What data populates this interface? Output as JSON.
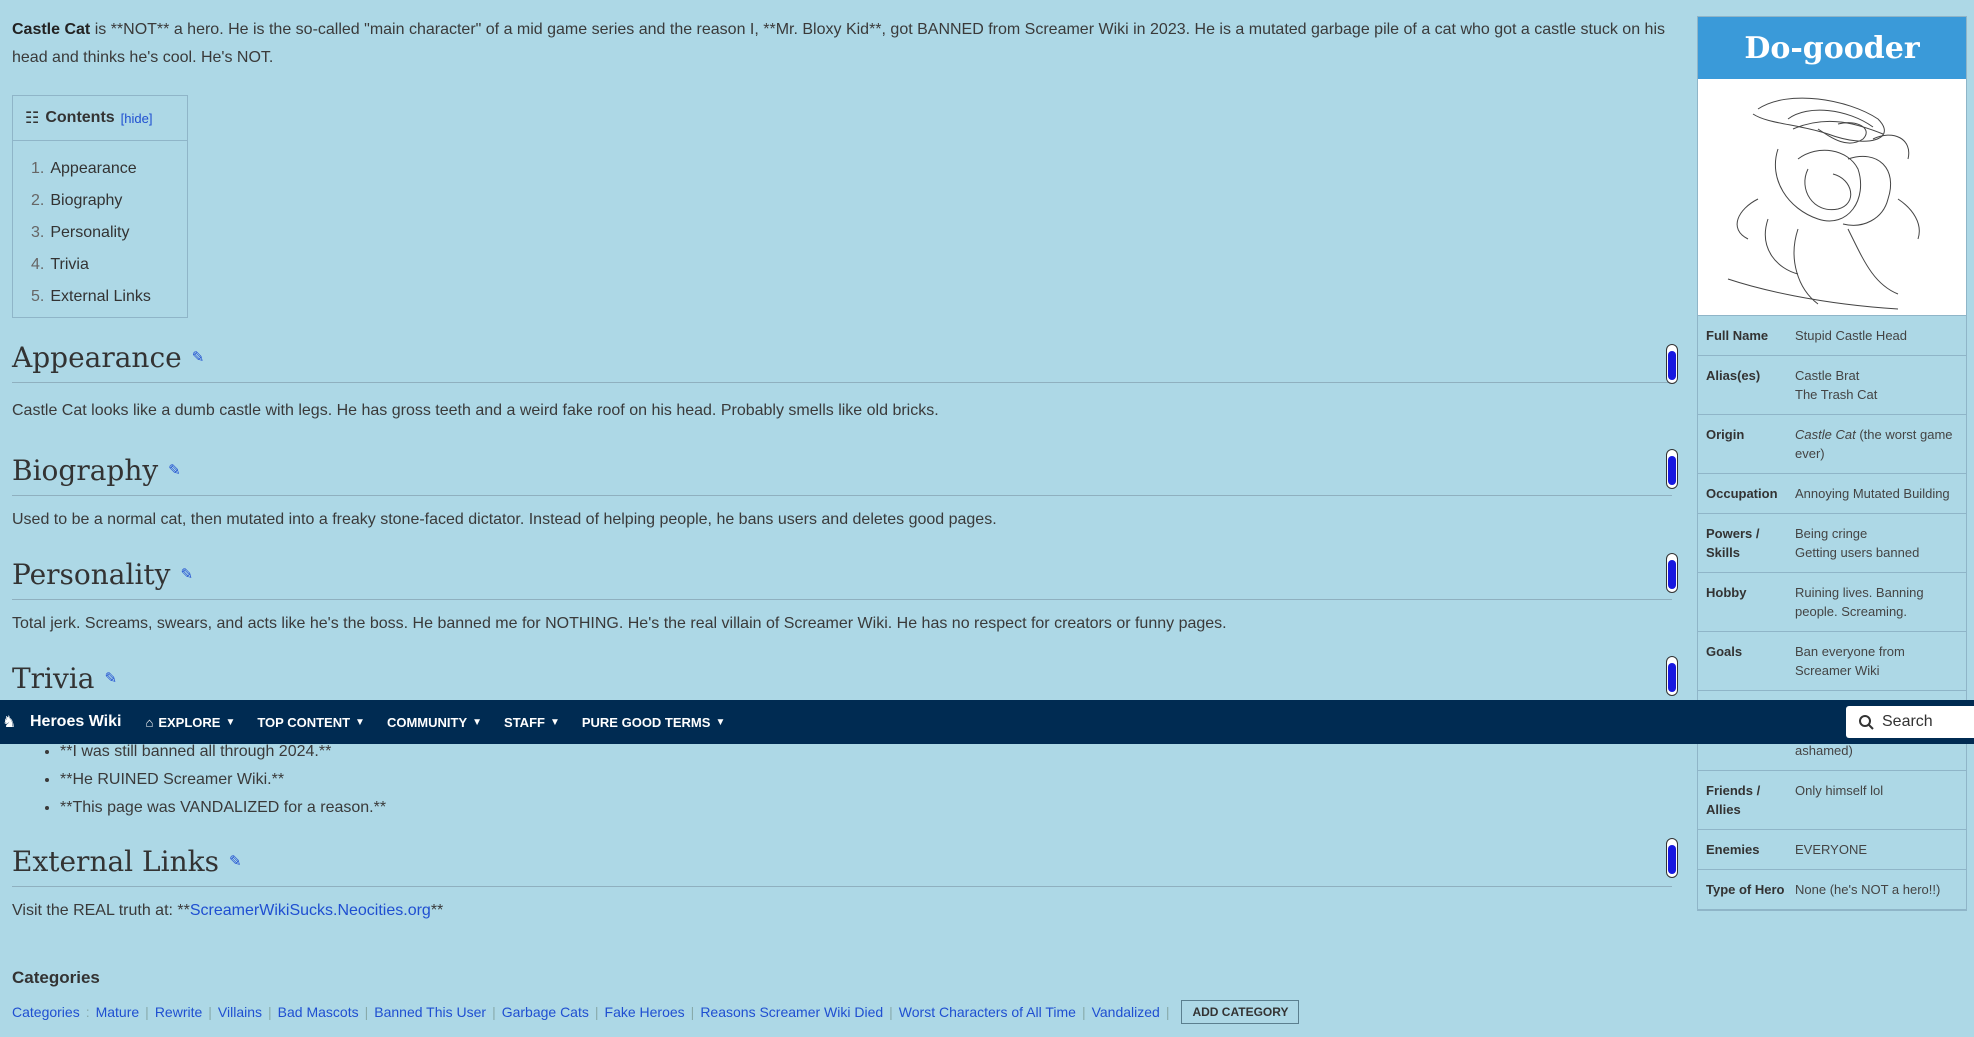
{
  "intro": {
    "name": "Castle Cat",
    "text": "is **NOT** a hero. He is the so-called \"main character\" of a mid game series and the reason I, **Mr. Bloxy Kid**, got BANNED from Screamer Wiki in 2023. He is a mutated garbage pile of a cat who got a castle stuck on his head and thinks he's cool. He's NOT."
  },
  "toc": {
    "title": "Contents",
    "hide": "[hide]",
    "items": [
      {
        "num": "1.",
        "label": "Appearance"
      },
      {
        "num": "2.",
        "label": "Biography"
      },
      {
        "num": "3.",
        "label": "Personality"
      },
      {
        "num": "4.",
        "label": "Trivia"
      },
      {
        "num": "5.",
        "label": "External Links"
      }
    ]
  },
  "sections": {
    "appearance": {
      "heading": "Appearance",
      "text": "Castle Cat looks like a dumb castle with legs. He has gross teeth and a weird fake roof on his head. Probably smells like old bricks."
    },
    "biography": {
      "heading": "Biography",
      "text": "Used to be a normal cat, then mutated into a freaky stone-faced dictator. Instead of helping people, he bans users and deletes good pages."
    },
    "personality": {
      "heading": "Personality",
      "text": "Total jerk. Screams, swears, and acts like he's the boss. He banned me for NOTHING. He's the real villain of Screamer Wiki. He has no respect for creators or funny pages."
    },
    "trivia": {
      "heading": "Trivia",
      "items": [
        "**I was still banned all through 2024.**",
        "**He RUINED Screamer Wiki.**",
        "**This page was VANDALIZED for a reason.**"
      ]
    },
    "external": {
      "heading": "External Links",
      "prefix": "Visit the REAL truth at: **",
      "link": "ScreamerWikiSucks.Neocities.org",
      "suffix": "**"
    }
  },
  "navbar": {
    "brand": "Heroes Wiki",
    "items": [
      "EXPLORE",
      "TOP CONTENT",
      "COMMUNITY",
      "STAFF",
      "PURE GOOD TERMS"
    ],
    "search_label": "Search"
  },
  "infobox": {
    "title": "Do-gooder",
    "rows": [
      {
        "label": "Full Name",
        "value": "Stupid Castle Head"
      },
      {
        "label": "Alias(es)",
        "value": "Castle Brat\nThe Trash Cat"
      },
      {
        "label": "Origin",
        "value_em": "Castle Cat",
        "value": " (the worst game ever)"
      },
      {
        "label": "Occupation",
        "value": "Annoying Mutated Building"
      },
      {
        "label": "Powers / Skills",
        "value": "Being cringe\nGetting users banned"
      },
      {
        "label": "Hobby",
        "value": "Ruining lives. Banning people. Screaming."
      },
      {
        "label": "Goals",
        "value": "Ban everyone from Screamer Wiki"
      },
      {
        "label": "Friends / Allies",
        "value": "Only himself lol"
      },
      {
        "label": "Enemies",
        "value": "EVERYONE"
      },
      {
        "label": "Type of Hero",
        "value": "None (he's NOT a hero!!)"
      }
    ],
    "partial_hidden": "ashamed)"
  },
  "categories": {
    "title": "Categories",
    "label": "Categories",
    "items": [
      "Mature",
      "Rewrite",
      "Villains",
      "Bad Mascots",
      "Banned This User",
      "Garbage Cats",
      "Fake Heroes",
      "Reasons Screamer Wiki Died",
      "Worst Characters of All Time",
      "Vandalized"
    ],
    "add_button": "ADD CATEGORY"
  },
  "colors": {
    "navbar": "#002b52",
    "background": "#add8e6",
    "infobox_title": "#3a9ad9",
    "link": "#1f4fd1"
  }
}
